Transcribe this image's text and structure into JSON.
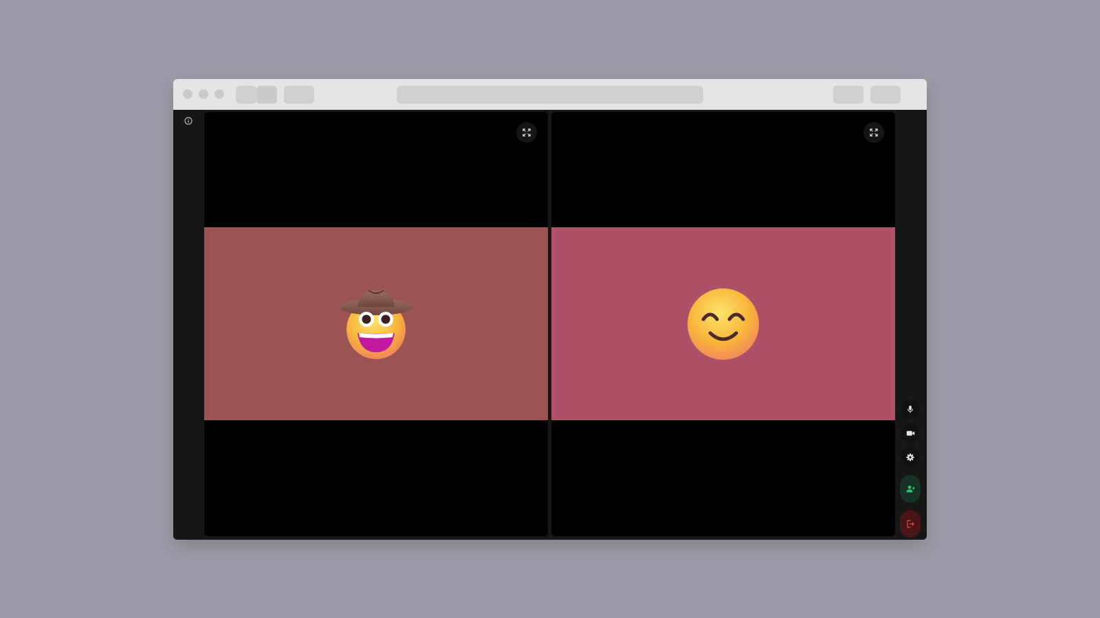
{
  "colors": {
    "desktop_bg": "#9d9da9",
    "app_bg": "#171717",
    "tile_bg": "#000000",
    "video_left_bg": "#9c5452",
    "video_right_bg": "#ad5068",
    "invite_bg": "#173325",
    "invite_fg": "#2fbf71",
    "leave_bg": "#4a1516",
    "leave_fg": "#e5484d"
  },
  "browser": {
    "traffic_lights": [
      "close-dot",
      "minimize-dot",
      "zoom-dot"
    ]
  },
  "sidebar": {
    "info_icon": "info-icon"
  },
  "participants": [
    {
      "avatar": "cowboy-face-emoji",
      "video_color": "#9c5452",
      "fullscreen_icon": "fullscreen-icon"
    },
    {
      "avatar": "smiling-face-emoji",
      "video_color": "#ad5068",
      "fullscreen_icon": "fullscreen-icon"
    }
  ],
  "controls": [
    {
      "name": "microphone",
      "icon": "microphone-icon"
    },
    {
      "name": "camera",
      "icon": "video-camera-icon"
    },
    {
      "name": "settings",
      "icon": "gear-icon"
    },
    {
      "name": "invite",
      "icon": "add-person-icon"
    },
    {
      "name": "leave",
      "icon": "leave-icon"
    }
  ]
}
